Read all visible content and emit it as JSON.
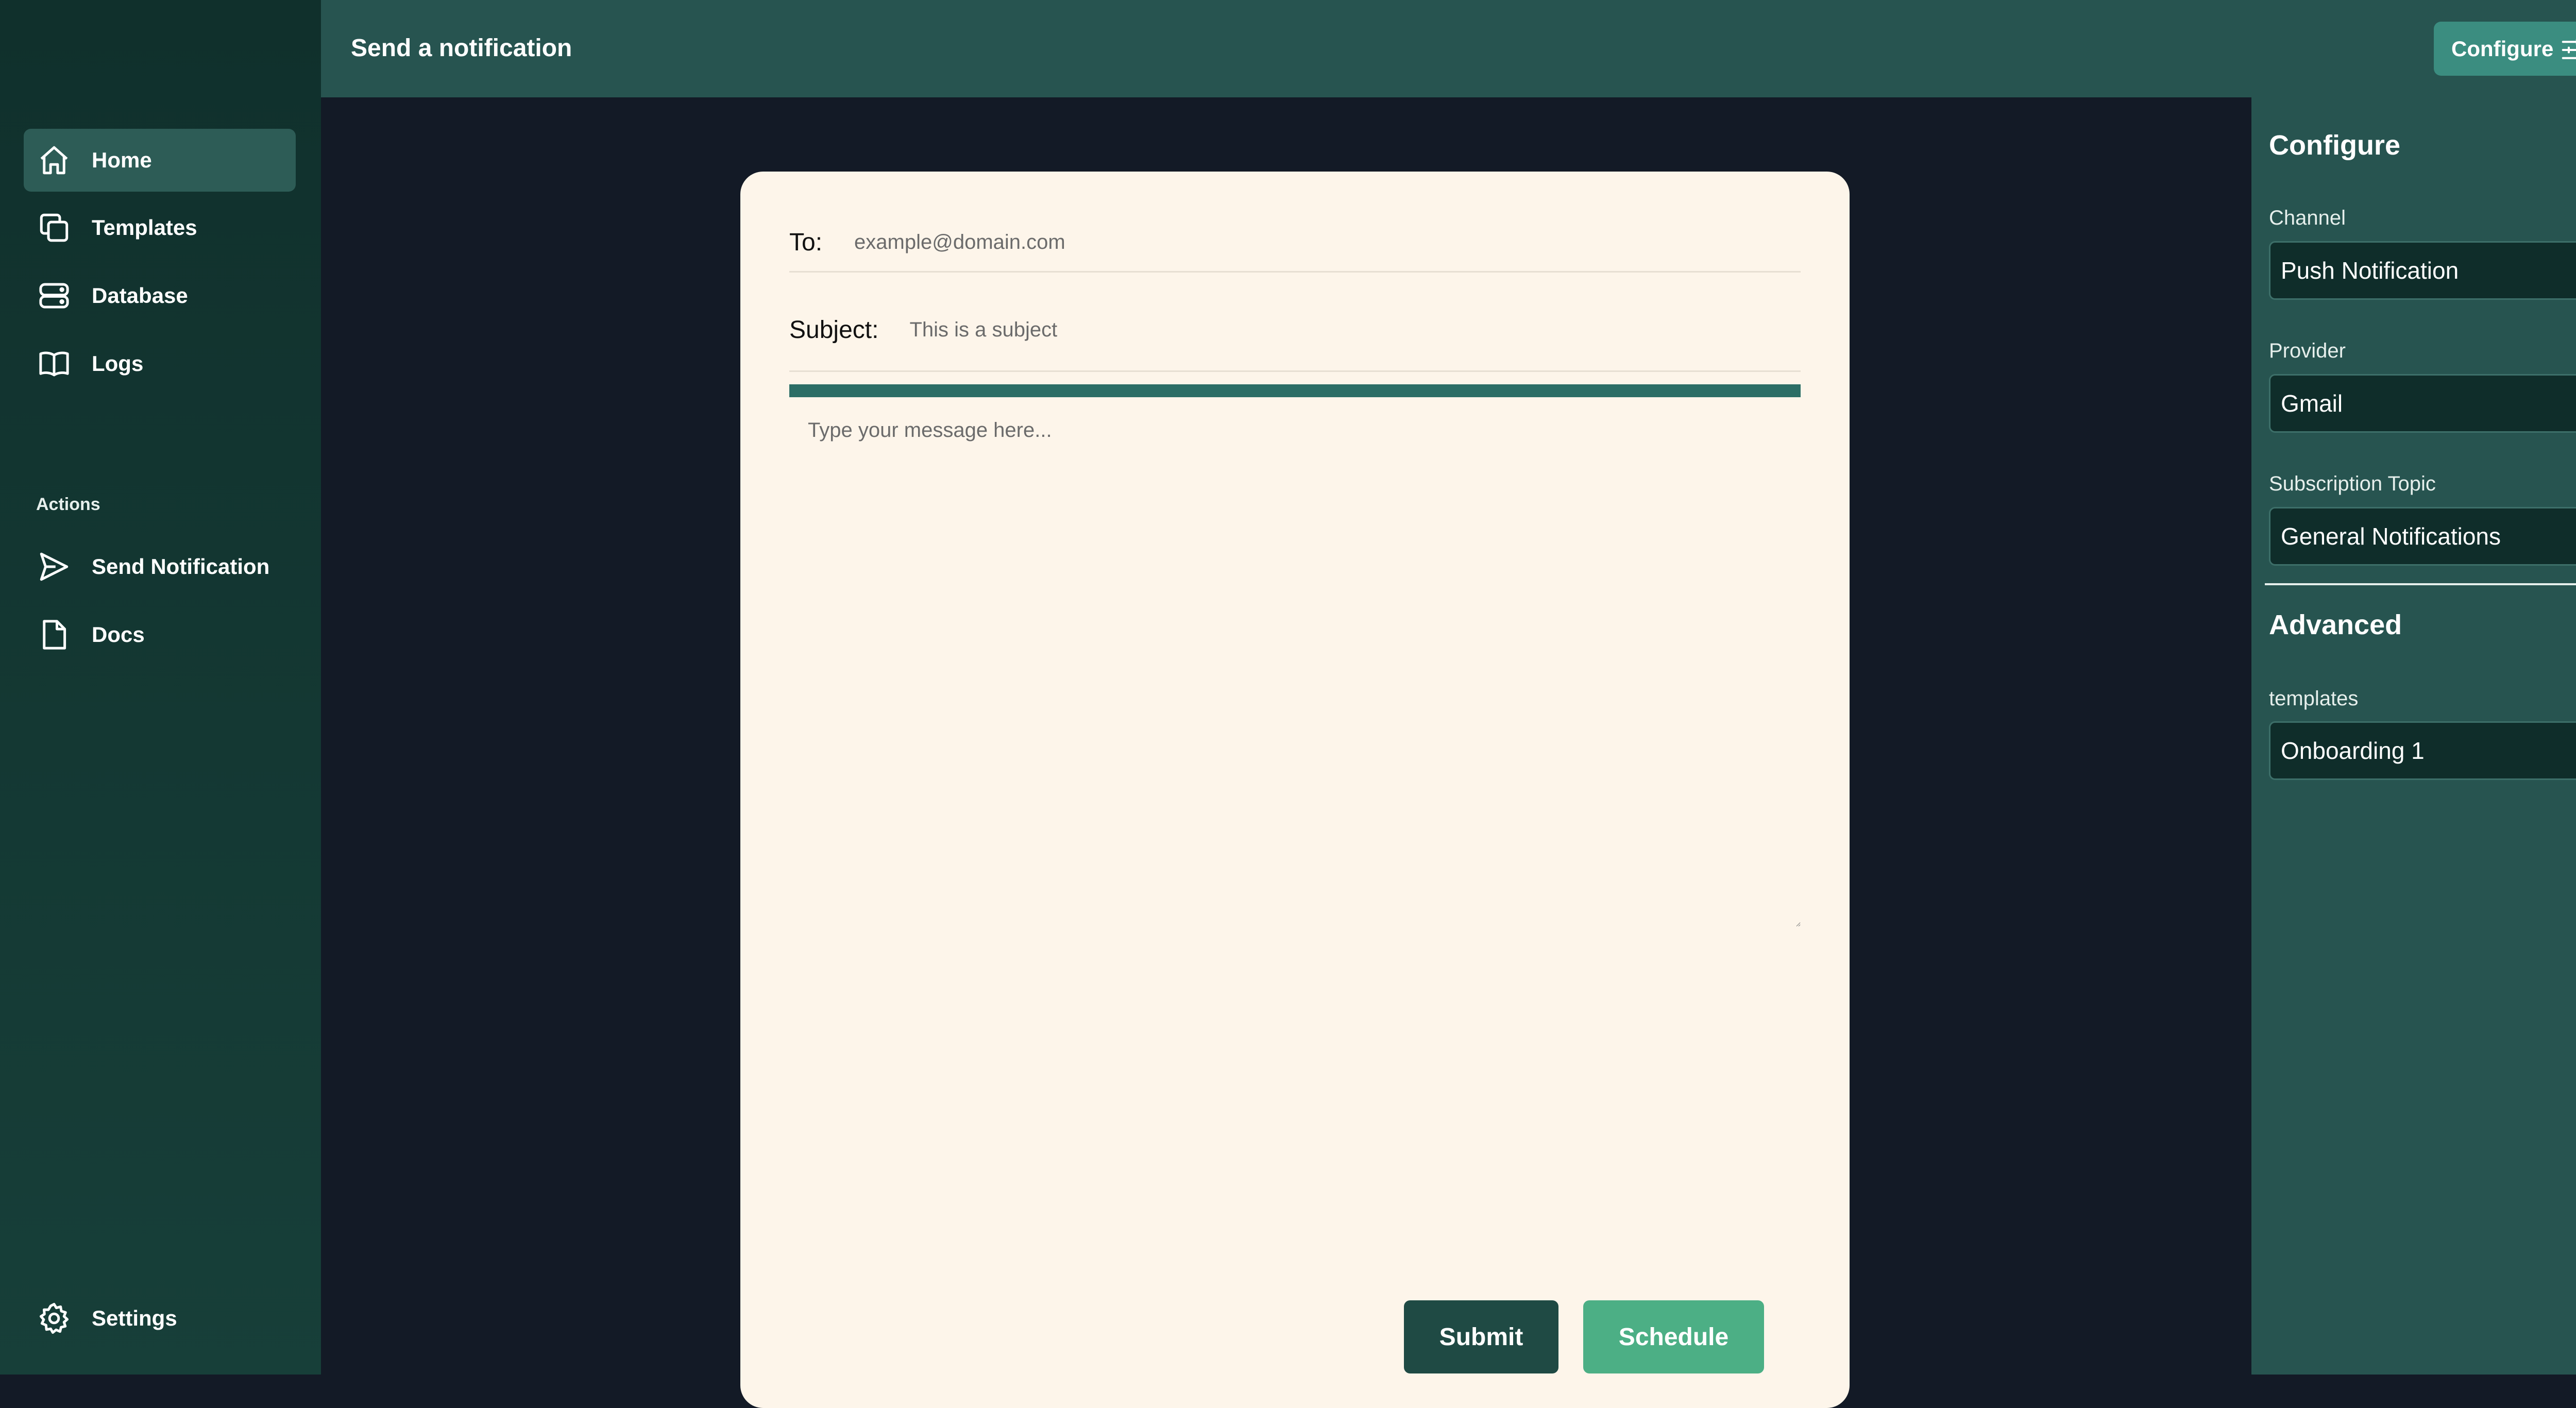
{
  "sidebar": {
    "items": [
      {
        "label": "Home",
        "icon": "home-icon",
        "active": true
      },
      {
        "label": "Templates",
        "icon": "copy-icon"
      },
      {
        "label": "Database",
        "icon": "database-icon"
      },
      {
        "label": "Logs",
        "icon": "book-icon"
      }
    ],
    "actions_label": "Actions",
    "actions": [
      {
        "label": "Send Notification",
        "icon": "send-icon"
      },
      {
        "label": "Docs",
        "icon": "document-icon"
      }
    ],
    "settings_label": "Settings"
  },
  "header": {
    "title": "Send a notification",
    "configure_label": "Configure"
  },
  "compose": {
    "to_label": "To:",
    "to_placeholder": "example@domain.com",
    "subject_label": "Subject:",
    "subject_placeholder": "This is a subject",
    "message_placeholder": "Type your message here...",
    "submit_label": "Submit",
    "schedule_label": "Schedule"
  },
  "panel": {
    "heading": "Configure",
    "channel_label": "Channel",
    "channel_value": "Push Notification",
    "provider_label": "Provider",
    "provider_value": "Gmail",
    "topic_label": "Subscription Topic",
    "topic_value": "General Notifications",
    "advanced_heading": "Advanced",
    "templates_label": "templates",
    "templates_value": "Onboarding 1"
  },
  "colors": {
    "sidebar": "#10302c",
    "header": "#275450",
    "content_bg": "#131a26",
    "card": "#fdf5ea",
    "accent": "#2c6e66",
    "schedule": "#4caf85"
  }
}
